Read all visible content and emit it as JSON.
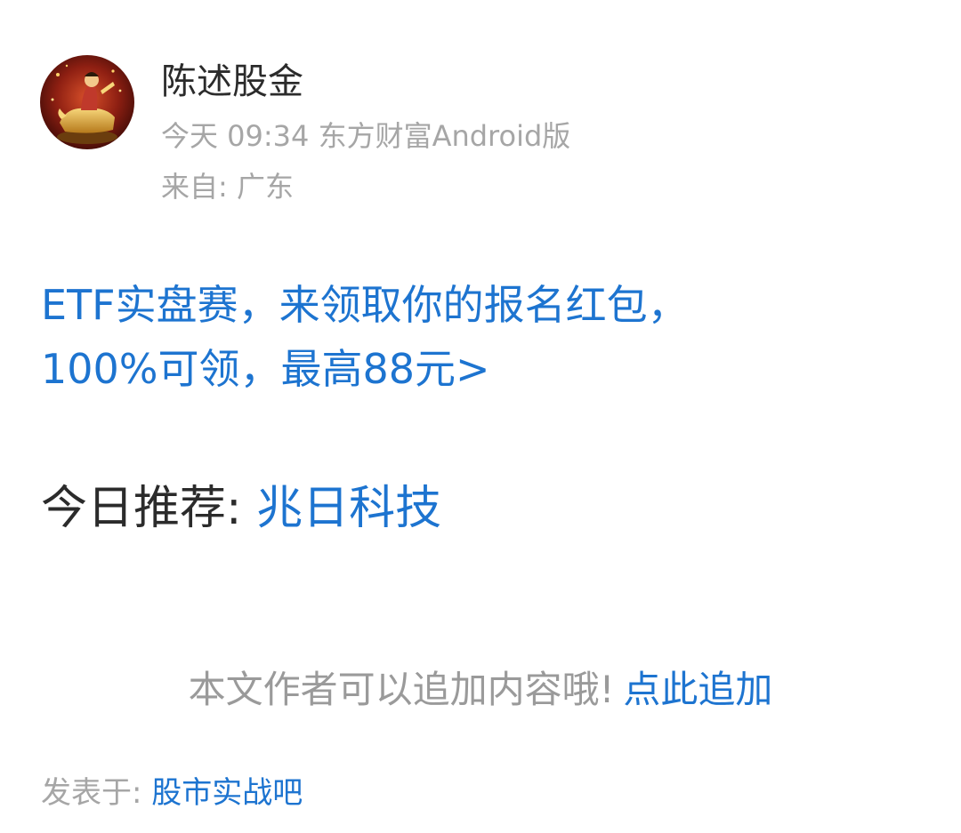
{
  "author": {
    "name": "陈述股金",
    "time": "今天 09:34 东方财富Android版",
    "from_label": "来自: ",
    "from_value": "广东"
  },
  "post": {
    "promo_line1": "ETF实盘赛，来领取你的报名红包，",
    "promo_line2": "100%可领，最高88元>",
    "recommend_label": "今日推荐: ",
    "recommend_stock": "兆日科技"
  },
  "append": {
    "text": "本文作者可以追加内容哦!",
    "link": "点此追加"
  },
  "posted": {
    "label": "发表于: ",
    "bar": "股市实战吧"
  },
  "colors": {
    "link": "#1d74d0",
    "text": "#2b2b2b",
    "muted": "#a6a6a6"
  },
  "icons": {
    "avatar": "avatar-image"
  }
}
